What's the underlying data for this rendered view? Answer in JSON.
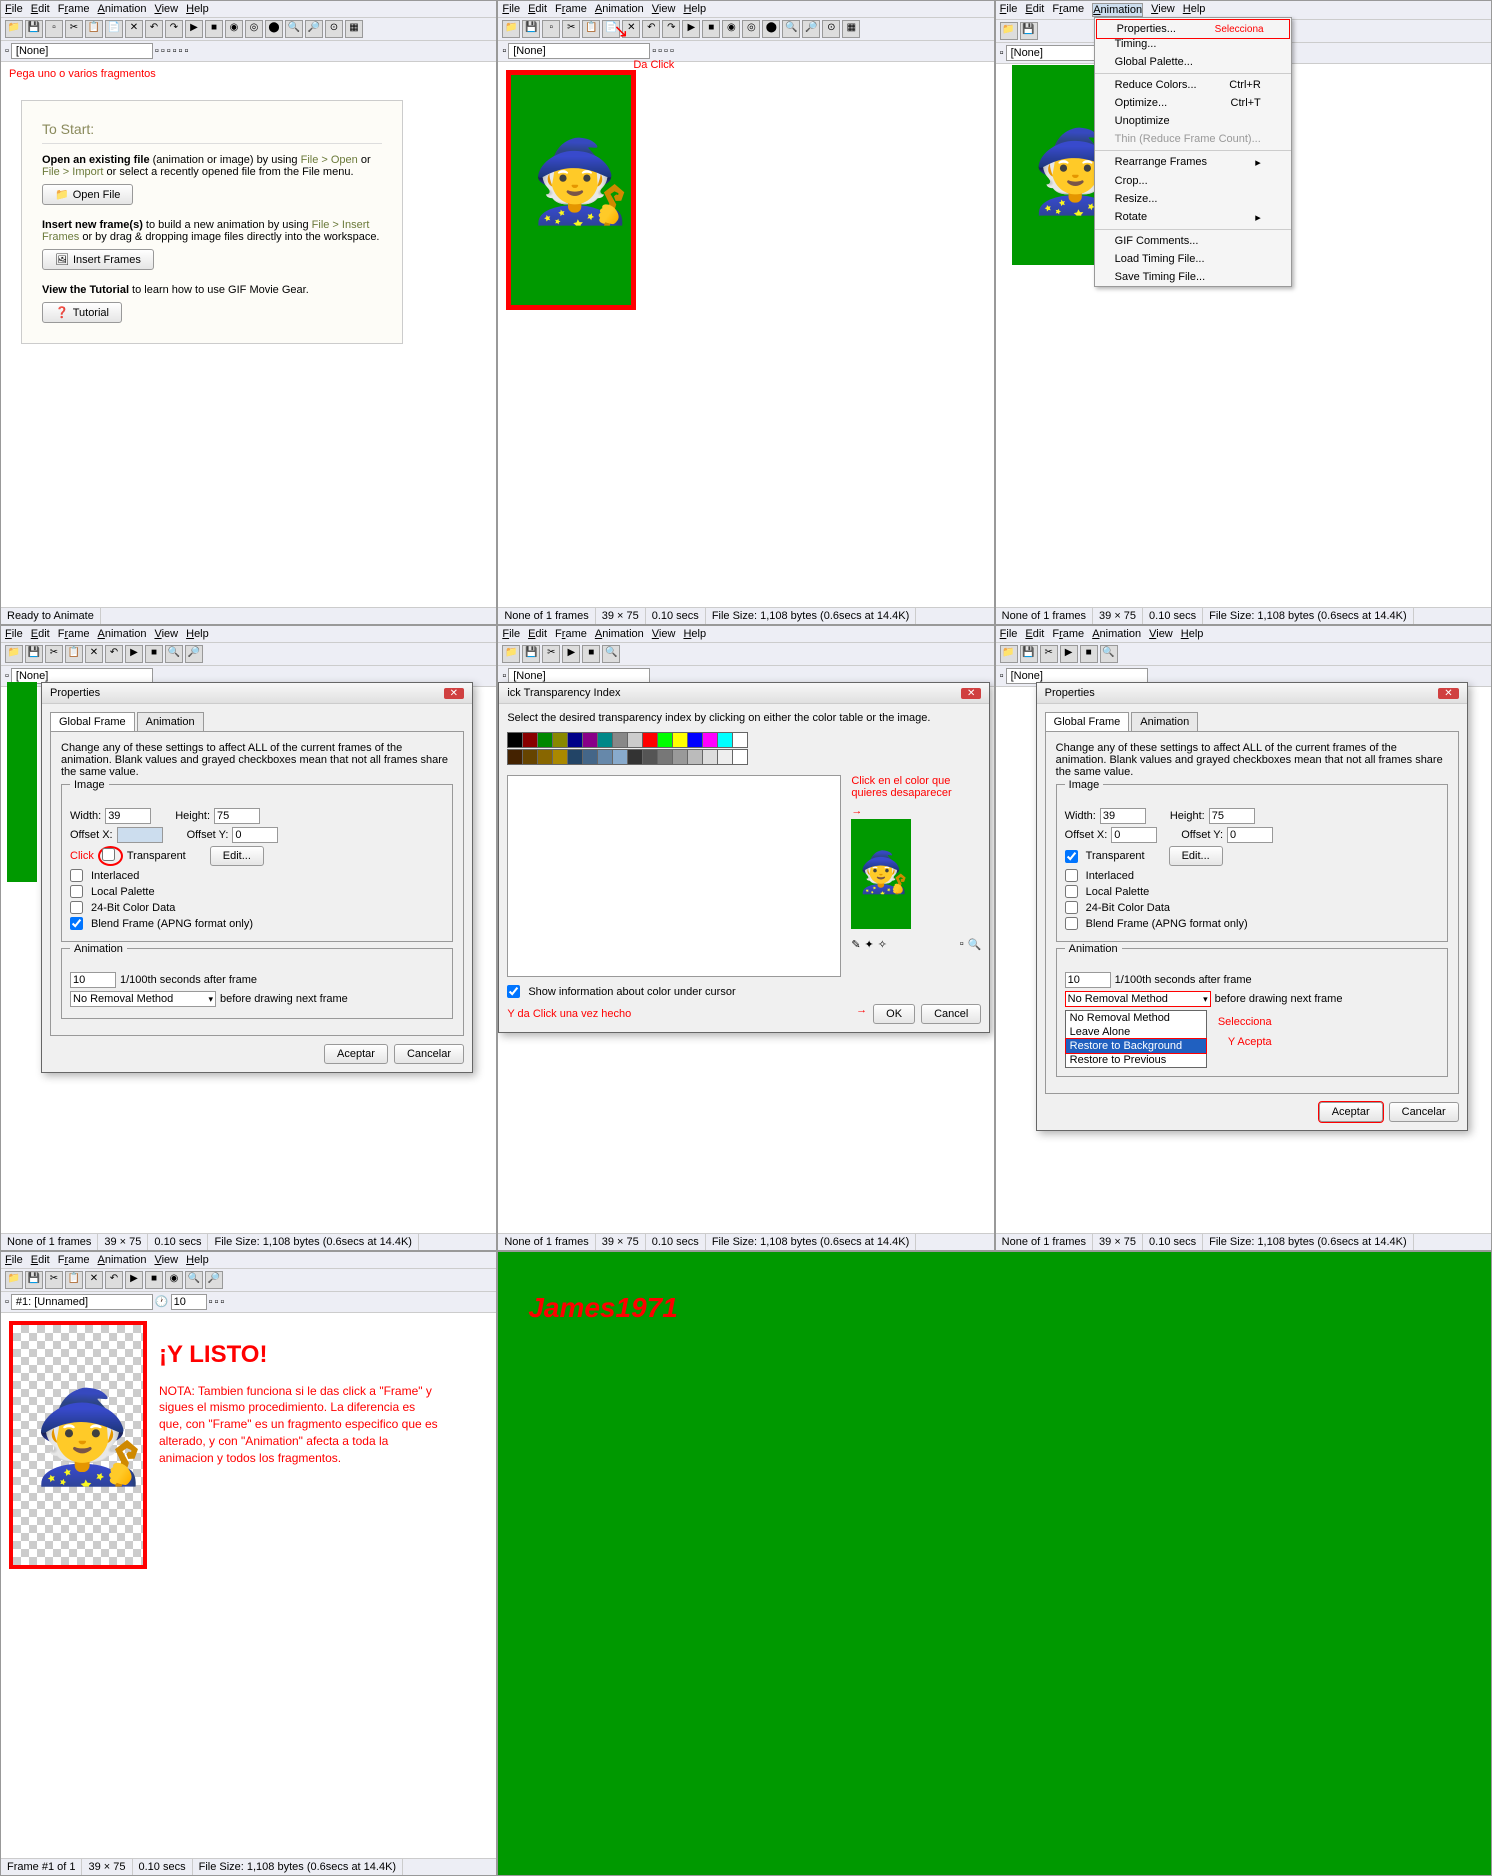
{
  "menu": {
    "file": "File",
    "edit": "Edit",
    "frame": "Frame",
    "anim": "Animation",
    "view": "View",
    "help": "Help"
  },
  "tb2": {
    "none": "[None]"
  },
  "red1": "Pega uno o varios fragmentos",
  "card": {
    "title": "To Start:",
    "p1a": "Open an existing file",
    "p1b": " (animation or image) by using ",
    "p1c": "File > Open",
    "p1d": " or ",
    "p1e": "File > Import",
    "p1f": " or select a recently opened file from the File menu.",
    "btn1": "Open File",
    "p2a": "Insert new frame(s)",
    "p2b": " to build a new animation by using ",
    "p2c": "File > Insert Frames",
    "p2d": " or by drag & dropping image files directly into the workspace.",
    "btn2": "Insert Frames",
    "p3a": "View the Tutorial",
    "p3b": " to learn how to use GIF Movie Gear.",
    "btn3": "Tutorial"
  },
  "status1": {
    "a": "Ready to Animate"
  },
  "status2": {
    "a": "None of 1 frames",
    "b": "39 × 75",
    "c": "0.10 secs",
    "d": "File Size: 1,108 bytes (0.6secs at 14.4K)"
  },
  "red2": "Da Click",
  "dd": {
    "props": "Properties...",
    "sel": "Selecciona",
    "timing": "Timing...",
    "gpal": "Global Palette...",
    "reduce": "Reduce Colors...",
    "opt": "Optimize...",
    "unopt": "Unoptimize",
    "thin": "Thin (Reduce Frame Count)...",
    "rearr": "Rearrange Frames",
    "crop": "Crop...",
    "resize": "Resize...",
    "rotate": "Rotate",
    "gif": "GIF Comments...",
    "loadt": "Load Timing File...",
    "savet": "Save Timing File...",
    "ctrlr": "Ctrl+R",
    "ctrlt": "Ctrl+T"
  },
  "props": {
    "title": "Properties",
    "tab1": "Global Frame",
    "tab2": "Animation",
    "desc": "Change any of these settings to affect ALL of the current frames of the animation. Blank values and grayed checkboxes mean that not all frames share the same value.",
    "image": "Image",
    "width": "Width:",
    "wv": "39",
    "height": "Height:",
    "hv": "75",
    "ox": "Offset X:",
    "oxv": "0",
    "oxvb": "",
    "oy": "Offset Y:",
    "oyv": "0",
    "trans": "Transparent",
    "edit": "Edit...",
    "inter": "Interlaced",
    "local": "Local Palette",
    "bit24": "24-Bit Color Data",
    "blend": "Blend Frame (APNG format only)",
    "anim": "Animation",
    "delay": "1/100th seconds after frame",
    "delayv": "10",
    "before": "before drawing next frame",
    "removal": "No Removal Method",
    "accept": "Aceptar",
    "cancel": "Cancelar",
    "click": "Click"
  },
  "pick": {
    "title": "ick Transparency Index",
    "desc": "Select the desired transparency index by clicking on either the color table or the image.",
    "show": "Show information about color under cursor",
    "clicknote": "Click en el color que quieres desaparecer",
    "yda": "Y da Click una vez hecho",
    "ok": "OK",
    "cancel": "Cancel"
  },
  "ddl": {
    "o1": "No Removal Method",
    "o2": "Leave Alone",
    "o3": "Restore to Background",
    "o4": "Restore to Previous",
    "sel": "Selecciona",
    "acep": "Y Acepta"
  },
  "p7": {
    "unnamed": "#1: [Unnamed]",
    "delay": "delay",
    "v10": "10",
    "listo": "¡Y LISTO!",
    "nota": "NOTA: Tambien funciona si le das click a \"Frame\" y sigues el mismo procedimiento. La diferencia es que, con \"Frame\" es un fragmento especifico que es alterado, y con \"Animation\" afecta a toda la animacion y todos los fragmentos."
  },
  "status7": {
    "a": "Frame #1 of 1",
    "b": "39 × 75",
    "c": "0.10 secs",
    "d": "File Size: 1,108 bytes (0.6secs at 14.4K)"
  },
  "sig": "James1971"
}
